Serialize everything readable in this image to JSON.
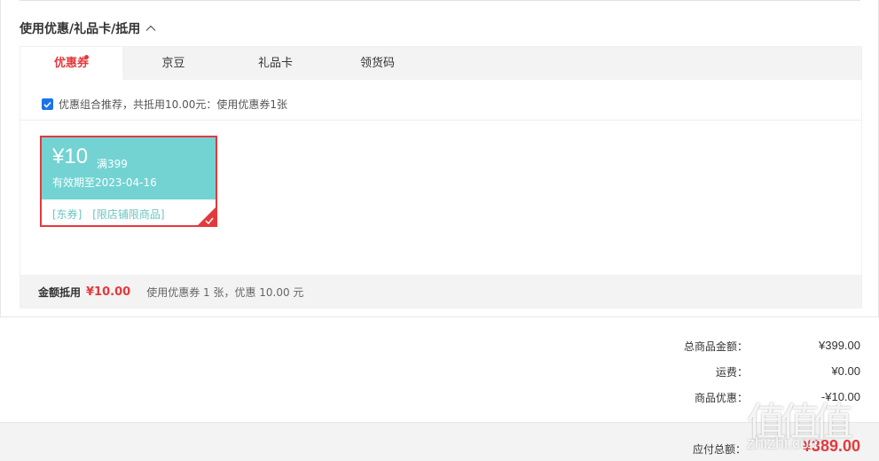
{
  "section": {
    "title": "使用优惠/礼品卡/抵用"
  },
  "tabs": [
    {
      "label": "优惠券",
      "active": true,
      "has_dot": true
    },
    {
      "label": "京豆",
      "active": false
    },
    {
      "label": "礼品卡",
      "active": false
    },
    {
      "label": "领货码",
      "active": false
    }
  ],
  "recommend": {
    "checked": true,
    "text": "优惠组合推荐，共抵用10.00元：使用优惠券1张"
  },
  "coupon": {
    "amount": "¥10",
    "condition": "满399",
    "valid": "有效期至2023-04-16",
    "tags": [
      "[东券]",
      "[限店铺限商品]"
    ],
    "selected": true
  },
  "summary": {
    "label": "金额抵用",
    "amount": "¥10.00",
    "desc": "使用优惠券 1 张，优惠 10.00 元"
  },
  "totals": {
    "goods_label": "总商品金额：",
    "goods_value": "¥399.00",
    "shipping_label": "运费：",
    "shipping_value": "¥0.00",
    "discount_label": "商品优惠：",
    "discount_value": "-¥10.00"
  },
  "footer": {
    "payable_label": "应付总额：",
    "payable_value": "¥389.00"
  },
  "watermark": {
    "glyphs": "值值值",
    "text": "zhizhi.com"
  },
  "colors": {
    "accent": "#e4393c",
    "coupon_bg": "#73d3d3",
    "checkbox": "#1a73e8"
  }
}
